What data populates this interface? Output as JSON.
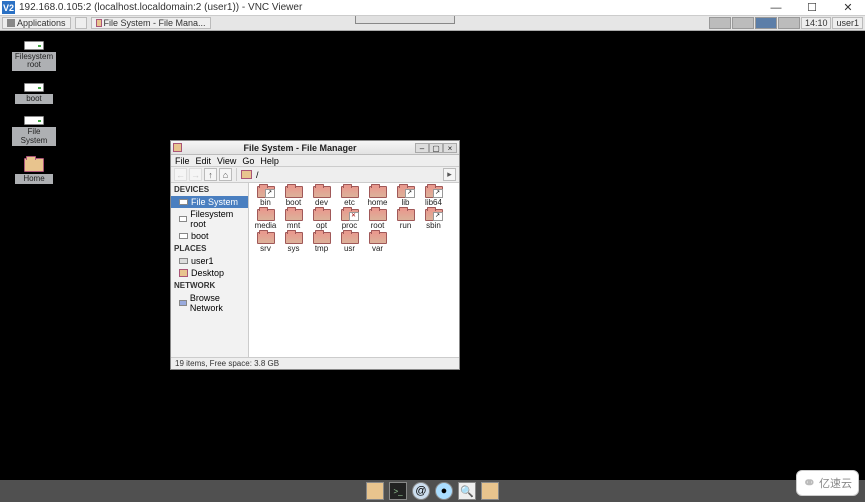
{
  "vnc": {
    "logo": "V2",
    "title": "192.168.0.105:2 (localhost.localdomain:2 (user1)) - VNC Viewer",
    "controls": {
      "min": "—",
      "max": "☐",
      "close": "✕"
    }
  },
  "taskbar": {
    "apps_label": "Applications",
    "task1_label": "File System - File Mana...",
    "clock": "14:10",
    "user": "user1"
  },
  "desktop_icons": [
    {
      "type": "disk",
      "label": "Filesystem root"
    },
    {
      "type": "disk",
      "label": "boot"
    },
    {
      "type": "disk",
      "label": "File System"
    },
    {
      "type": "folder",
      "label": "Home"
    }
  ],
  "fm": {
    "title": "File System - File Manager",
    "menu": {
      "file": "File",
      "edit": "Edit",
      "view": "View",
      "go": "Go",
      "help": "Help"
    },
    "nav": {
      "back": "←",
      "fwd": "→",
      "up": "↑",
      "home": "⌂",
      "path_root": "/",
      "overflow": "▸"
    },
    "wincontrols": {
      "min": "–",
      "max": "▢",
      "close": "×"
    },
    "side": {
      "hdr_devices": "DEVICES",
      "dev_fs": "File System",
      "dev_root": "Filesystem root",
      "dev_boot": "boot",
      "hdr_places": "PLACES",
      "pl_user": "user1",
      "pl_desktop": "Desktop",
      "hdr_network": "NETWORK",
      "net_browse": "Browse Network"
    },
    "folders": [
      {
        "name": "bin",
        "deco": "link"
      },
      {
        "name": "boot",
        "deco": ""
      },
      {
        "name": "dev",
        "deco": ""
      },
      {
        "name": "etc",
        "deco": ""
      },
      {
        "name": "home",
        "deco": ""
      },
      {
        "name": "lib",
        "deco": "link"
      },
      {
        "name": "lib64",
        "deco": "link"
      },
      {
        "name": "media",
        "deco": ""
      },
      {
        "name": "mnt",
        "deco": ""
      },
      {
        "name": "opt",
        "deco": ""
      },
      {
        "name": "proc",
        "deco": "x"
      },
      {
        "name": "root",
        "deco": ""
      },
      {
        "name": "run",
        "deco": ""
      },
      {
        "name": "sbin",
        "deco": "link"
      },
      {
        "name": "srv",
        "deco": ""
      },
      {
        "name": "sys",
        "deco": ""
      },
      {
        "name": "tmp",
        "deco": ""
      },
      {
        "name": "usr",
        "deco": ""
      },
      {
        "name": "var",
        "deco": ""
      }
    ],
    "status": "19 items, Free space: 3.8 GB"
  },
  "dock": {
    "items": [
      "folder",
      "term",
      "web",
      "globe",
      "search",
      "folder"
    ]
  },
  "watermark": {
    "symbol": "⚭",
    "text": "亿速云"
  }
}
